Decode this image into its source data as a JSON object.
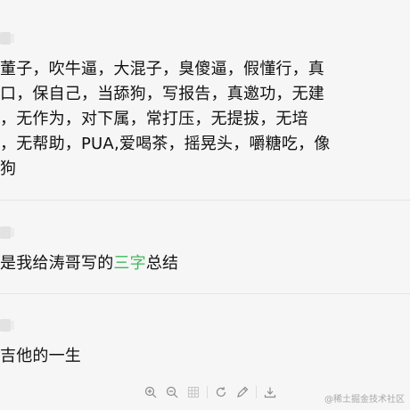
{
  "comments": [
    {
      "lines": [
        "董子，吹牛逼，大混子，臭傻逼，假懂行，真",
        "口，保自己，当舔狗，写报告，真邀功，无建",
        "，无作为，对下属，常打压，无提拔，无培",
        "，无帮助，PUA,爱喝茶，摇晃头，嚼糖吃，像",
        "狗"
      ]
    },
    {
      "prefix": "是我给涛哥写的",
      "highlight": "三字",
      "suffix": "总结"
    },
    {
      "lines": [
        "吉他的一生"
      ]
    }
  ],
  "toolbar": {
    "items": [
      {
        "name": "zoom-in-icon"
      },
      {
        "name": "zoom-out-icon"
      },
      {
        "name": "grid-icon"
      },
      {
        "name": "rotate-icon"
      },
      {
        "name": "edit-icon"
      },
      {
        "name": "download-icon"
      }
    ]
  },
  "watermark": "@稀土掘金技术社区",
  "colors": {
    "highlight": "#3dba5c",
    "background": "#f6f6f6",
    "icon": "#8c8c8c"
  }
}
